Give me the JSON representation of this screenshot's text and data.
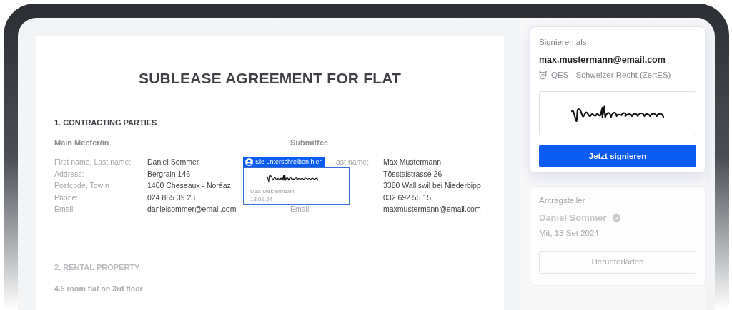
{
  "document": {
    "title": "SUBLEASE AGREEMENT FOR FLAT",
    "section_1": {
      "heading": "1. CONTRACTING PARTIES",
      "parties": [
        {
          "heading": "Main Meeter/in",
          "rows": [
            {
              "label": "First name, Last name:",
              "value": "Daniel Sommer"
            },
            {
              "label": "Address:",
              "value": "Bergrain 146"
            },
            {
              "label": "Postcode, Tow:n",
              "value": "1400 Cheseaux - Noréaz"
            },
            {
              "label": "Phone:",
              "value": "024 865 39 23"
            },
            {
              "label": "Email:",
              "value": "danielsommer@email.com"
            }
          ]
        },
        {
          "heading": "Submittee",
          "rows": [
            {
              "label": "ast name:",
              "label_cut": true,
              "value": "Max Mustermann"
            },
            {
              "value": "Tösstalstrasse 26"
            },
            {
              "value": "3380 Walliswil bei Niederbipp"
            },
            {
              "value": "032 692 55 15"
            },
            {
              "label": "Email:",
              "value": "maxmustermann@email.com"
            }
          ]
        }
      ]
    },
    "signature_field": {
      "banner": "Sie unterschreiben hier",
      "name": "Max Mustermann",
      "date": "13.09.24"
    },
    "section_2": {
      "heading": "2. RENTAL PROPERTY",
      "subheading": "4.5 room flat on 3rd floor"
    }
  },
  "sign_card": {
    "label": "Signieren als",
    "email": "max.mustermann@email.com",
    "method": "QES - Schweizer Recht (ZertES)",
    "button": "Jetzt signieren"
  },
  "requester_card": {
    "label": "Antragsteller",
    "name": "Daniel Sommer",
    "verified": true,
    "date": "Mit, 13 Set 2024",
    "button": "Herunterladen"
  }
}
